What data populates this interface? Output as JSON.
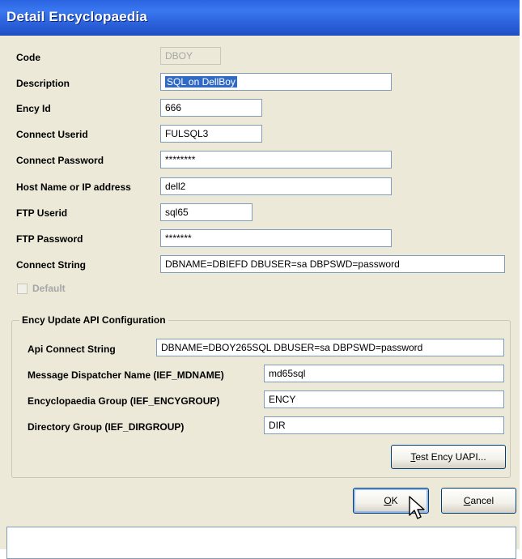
{
  "window": {
    "title": "Detail Encyclopaedia"
  },
  "form": {
    "code_label": "Code",
    "code_value": "DBOY",
    "description_label": "Description",
    "description_value": "SQL on DellBoy",
    "ency_id_label": "Ency Id",
    "ency_id_value": "666",
    "connect_userid_label": "Connect  Userid",
    "connect_userid_value": "FULSQL3",
    "connect_password_label": "Connect Password",
    "connect_password_value": "********",
    "host_label": "Host Name or IP address",
    "host_value": "dell2",
    "ftp_userid_label": "FTP Userid",
    "ftp_userid_value": "sql65",
    "ftp_password_label": "FTP Password",
    "ftp_password_value": "*******",
    "connect_string_label": "Connect String",
    "connect_string_value": "DBNAME=DBIEFD DBUSER=sa DBPSWD=password",
    "default_checkbox_label": "Default"
  },
  "uapi": {
    "group_title": "Ency Update API Configuration",
    "api_connect_label": "Api Connect String",
    "api_connect_value": "DBNAME=DBOY265SQL DBUSER=sa DBPSWD=password",
    "mdname_label": "Message Dispatcher Name (IEF_MDNAME)",
    "mdname_value": "md65sql",
    "encygroup_label": "Encyclopaedia Group (IEF_ENCYGROUP)",
    "encygroup_value": "ENCY",
    "dirgroup_label": "Directory Group (IEF_DIRGROUP)",
    "dirgroup_value": "DIR",
    "test_button_label_mn": "T",
    "test_button_label_rest": "est Ency UAPI..."
  },
  "buttons": {
    "ok_mn": "O",
    "ok_rest": "K",
    "cancel_mn": "C",
    "cancel_rest": "ancel"
  }
}
